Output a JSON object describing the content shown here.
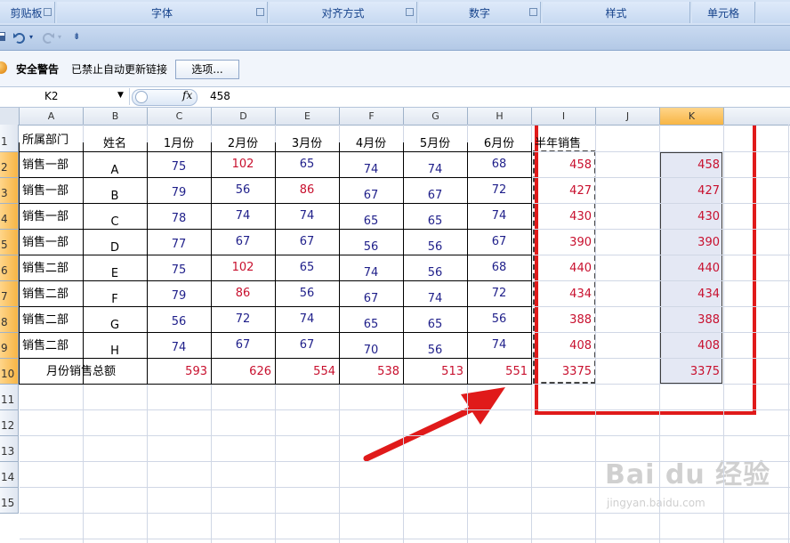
{
  "ribbon": {
    "groups": [
      {
        "label": "剪贴板"
      },
      {
        "label": "字体"
      },
      {
        "label": "对齐方式"
      },
      {
        "label": "数字"
      },
      {
        "label": "样式"
      },
      {
        "label": "单元格"
      }
    ]
  },
  "security": {
    "title": "安全警告",
    "message": "已禁止自动更新链接",
    "options_label": "选项..."
  },
  "formula_bar": {
    "name_box": "K2",
    "fx_label": "fx",
    "value": "458"
  },
  "grid": {
    "columns": [
      "A",
      "B",
      "C",
      "D",
      "E",
      "F",
      "G",
      "H",
      "I",
      "J",
      "K"
    ],
    "rows": [
      "1",
      "2",
      "3",
      "4",
      "5",
      "6",
      "7",
      "8",
      "9",
      "10",
      "11",
      "12",
      "13",
      "14",
      "15"
    ],
    "header_row": [
      "所属部门",
      "姓名",
      "1月份",
      "2月份",
      "3月份",
      "4月份",
      "5月份",
      "6月份",
      "半年销售"
    ],
    "data_rows": [
      {
        "dept": "销售一部",
        "name": "A",
        "m": [
          "75",
          "102",
          "65",
          "74",
          "74",
          "68"
        ],
        "total": "458",
        "k": "458"
      },
      {
        "dept": "销售一部",
        "name": "B",
        "m": [
          "79",
          "56",
          "86",
          "67",
          "67",
          "72"
        ],
        "total": "427",
        "k": "427"
      },
      {
        "dept": "销售一部",
        "name": "C",
        "m": [
          "78",
          "74",
          "74",
          "65",
          "65",
          "74"
        ],
        "total": "430",
        "k": "430"
      },
      {
        "dept": "销售一部",
        "name": "D",
        "m": [
          "77",
          "67",
          "67",
          "56",
          "56",
          "67"
        ],
        "total": "390",
        "k": "390"
      },
      {
        "dept": "销售二部",
        "name": "E",
        "m": [
          "75",
          "102",
          "65",
          "74",
          "56",
          "68"
        ],
        "total": "440",
        "k": "440"
      },
      {
        "dept": "销售二部",
        "name": "F",
        "m": [
          "79",
          "86",
          "56",
          "67",
          "74",
          "72"
        ],
        "total": "434",
        "k": "434"
      },
      {
        "dept": "销售二部",
        "name": "G",
        "m": [
          "56",
          "72",
          "74",
          "65",
          "65",
          "56"
        ],
        "total": "388",
        "k": "388"
      },
      {
        "dept": "销售二部",
        "name": "H",
        "m": [
          "74",
          "67",
          "67",
          "70",
          "56",
          "74"
        ],
        "total": "408",
        "k": "408"
      }
    ],
    "totals_row": {
      "label": "月份销售总额",
      "m": [
        "593",
        "626",
        "554",
        "538",
        "513",
        "551"
      ],
      "total": "3375",
      "k": "3375"
    }
  },
  "colors": {
    "red": "#c8102e",
    "blue": "#1f1f8a",
    "annotation": "#e01a1a"
  },
  "icons": [
    "save-icon",
    "undo-icon",
    "redo-icon",
    "customize-icon",
    "shield-icon",
    "name-box-dropdown-icon",
    "fx-icon",
    "red-arrow-annotation"
  ]
}
